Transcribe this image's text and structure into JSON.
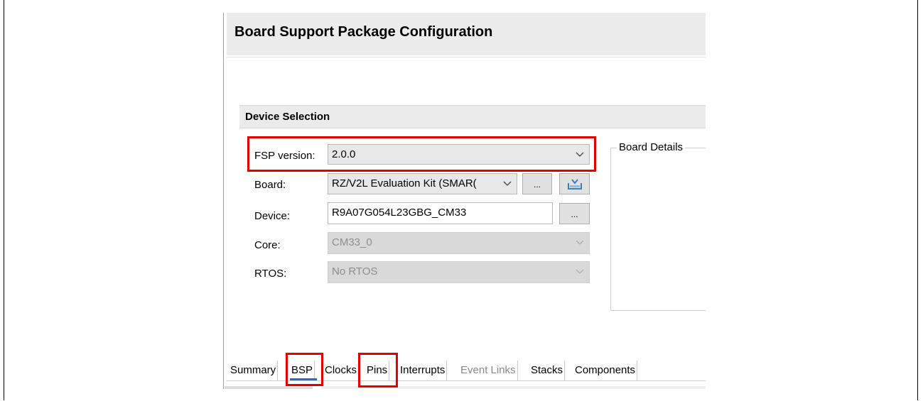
{
  "editor": {
    "title": "Board Support Package Configuration"
  },
  "device_selection": {
    "title": "Device Selection",
    "fsp_version": {
      "label": "FSP version:",
      "value": "2.0.0"
    },
    "board": {
      "label": "Board:",
      "value": "RZ/V2L Evaluation Kit (SMAR(",
      "browse_label": "..."
    },
    "device": {
      "label": "Device:",
      "value": "R9A07G054L23GBG_CM33",
      "browse_label": "..."
    },
    "core": {
      "label": "Core:",
      "value": "CM33_0"
    },
    "rtos": {
      "label": "RTOS:",
      "value": "No RTOS"
    }
  },
  "board_details": {
    "title": "Board Details"
  },
  "tabs": [
    {
      "label": "Summary",
      "active": false,
      "enabled": true
    },
    {
      "label": "BSP",
      "active": true,
      "enabled": true
    },
    {
      "label": "Clocks",
      "active": false,
      "enabled": true
    },
    {
      "label": "Pins",
      "active": false,
      "enabled": true
    },
    {
      "label": "Interrupts",
      "active": false,
      "enabled": true
    },
    {
      "label": "Event Links",
      "active": false,
      "enabled": false
    },
    {
      "label": "Stacks",
      "active": false,
      "enabled": true
    },
    {
      "label": "Components",
      "active": false,
      "enabled": true
    }
  ],
  "annotation_color": "#e00000",
  "accent_color": "#2a6cc2"
}
